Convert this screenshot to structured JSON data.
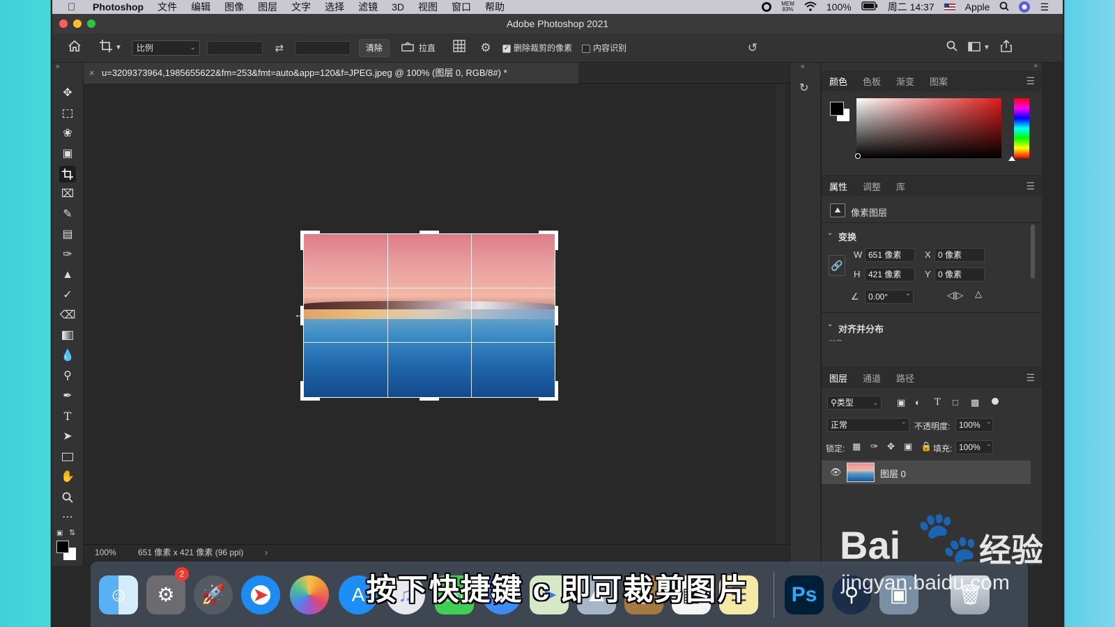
{
  "menubar": {
    "app_name": "Photoshop",
    "menus": [
      "文件",
      "编辑",
      "图像",
      "图层",
      "文字",
      "选择",
      "滤镜",
      "3D",
      "视图",
      "窗口",
      "帮助"
    ],
    "mem_label": "MEM",
    "mem_value": "83%",
    "battery": "100%",
    "clock": "周二 14:37",
    "user": "Apple"
  },
  "window": {
    "title": "Adobe Photoshop 2021"
  },
  "options": {
    "ratio_select": "比例",
    "clear_button": "清除",
    "straighten_button": "拉直",
    "delete_cropped_label": "删除裁剪的像素",
    "delete_cropped_checked": true,
    "content_aware_label": "内容识别",
    "content_aware_checked": false
  },
  "document": {
    "tab_close": "×",
    "tab_title": "u=3209373964,1985655622&fm=253&fmt=auto&app=120&f=JPEG.jpeg @ 100% (图层 0, RGB/8#) *",
    "zoom": "100%",
    "info": "651 像素 x 421 像素 (96 ppi)",
    "info_arrow": "›"
  },
  "color_panel": {
    "tabs": [
      "颜色",
      "色板",
      "渐变",
      "图案"
    ],
    "foreground": "#000000",
    "background": "#ffffff",
    "hue_color": "#e01b1b"
  },
  "properties_panel": {
    "tabs": [
      "属性",
      "调整",
      "库"
    ],
    "layer_type": "像素图层",
    "transform_title": "变换",
    "w_label": "W",
    "w_value": "651 像素",
    "h_label": "H",
    "h_value": "421 像素",
    "x_label": "X",
    "x_value": "0 像素",
    "y_label": "Y",
    "y_value": "0 像素",
    "angle_value": "0.00°",
    "align_title": "对齐并分布",
    "align_sub": "对齐:"
  },
  "layers_panel": {
    "tabs": [
      "图层",
      "通道",
      "路径"
    ],
    "filter_type": "类型",
    "blend_mode": "正常",
    "opacity_label": "不透明度:",
    "opacity_value": "100%",
    "lock_label": "锁定:",
    "fill_label": "填充:",
    "fill_value": "100%",
    "layers": [
      {
        "name": "图层 0",
        "visible": true
      }
    ]
  },
  "dock": {
    "settings_badge": "2",
    "ps_label": "Ps"
  },
  "subtitle": "按下快捷键 c 即可裁剪图片",
  "watermark": {
    "brand": "Bai",
    "brand_suffix": "经验",
    "domain": "jingyan.baidu.com"
  }
}
